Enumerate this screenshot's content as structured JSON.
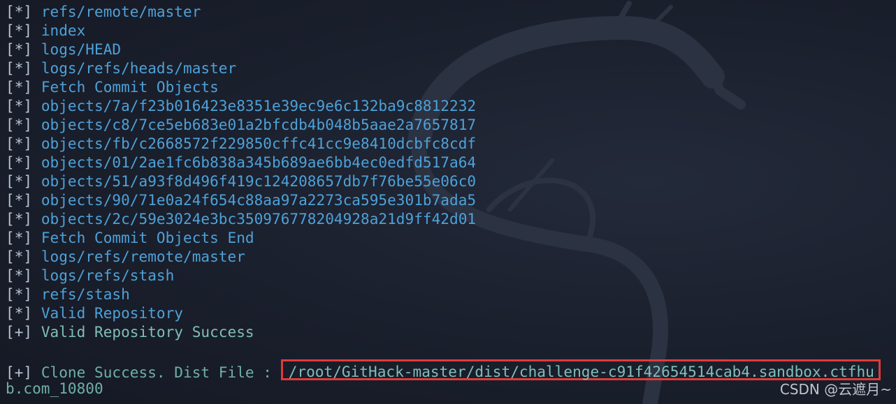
{
  "terminal": {
    "lines": [
      {
        "prefix": "[*]",
        "text": "refs/remote/master"
      },
      {
        "prefix": "[*]",
        "text": "index"
      },
      {
        "prefix": "[*]",
        "text": "logs/HEAD"
      },
      {
        "prefix": "[*]",
        "text": "logs/refs/heads/master"
      },
      {
        "prefix": "[*]",
        "text": "Fetch Commit Objects"
      },
      {
        "prefix": "[*]",
        "text": "objects/7a/f23b016423e8351e39ec9e6c132ba9c8812232"
      },
      {
        "prefix": "[*]",
        "text": "objects/c8/7ce5eb683e01a2bfcdb4b048b5aae2a7657817"
      },
      {
        "prefix": "[*]",
        "text": "objects/fb/c2668572f229850cffc41cc9e8410dcbfc8cdf"
      },
      {
        "prefix": "[*]",
        "text": "objects/01/2ae1fc6b838a345b689ae6bb4ec0edfd517a64"
      },
      {
        "prefix": "[*]",
        "text": "objects/51/a93f8d496f419c124208657db7f76be55e06c0"
      },
      {
        "prefix": "[*]",
        "text": "objects/90/71e0a24f654c88aa97a2273ca595e301b7ada5"
      },
      {
        "prefix": "[*]",
        "text": "objects/2c/59e3024e3bc350976778204928a21d9ff42d01"
      },
      {
        "prefix": "[*]",
        "text": "Fetch Commit Objects End"
      },
      {
        "prefix": "[*]",
        "text": "logs/refs/remote/master"
      },
      {
        "prefix": "[*]",
        "text": "logs/refs/stash"
      },
      {
        "prefix": "[*]",
        "text": "refs/stash"
      },
      {
        "prefix": "[*]",
        "text": "Valid Repository"
      },
      {
        "prefix": "[+]",
        "text": "Valid Repository Success"
      }
    ],
    "clone": {
      "prefix": "[+]",
      "text": "Clone Success. Dist File :",
      "path": "/root/GitHack-master/dist/challenge-c91f42654514cab4.sandbox.ctfhu",
      "path_cont": "b.com_10800"
    }
  },
  "watermark": "CSDN @云遮月~",
  "colors": {
    "background": "#1c2130",
    "info_text": "#4ea1d8",
    "success_text": "#6fb0a8",
    "highlight_box": "#e03a3a"
  }
}
